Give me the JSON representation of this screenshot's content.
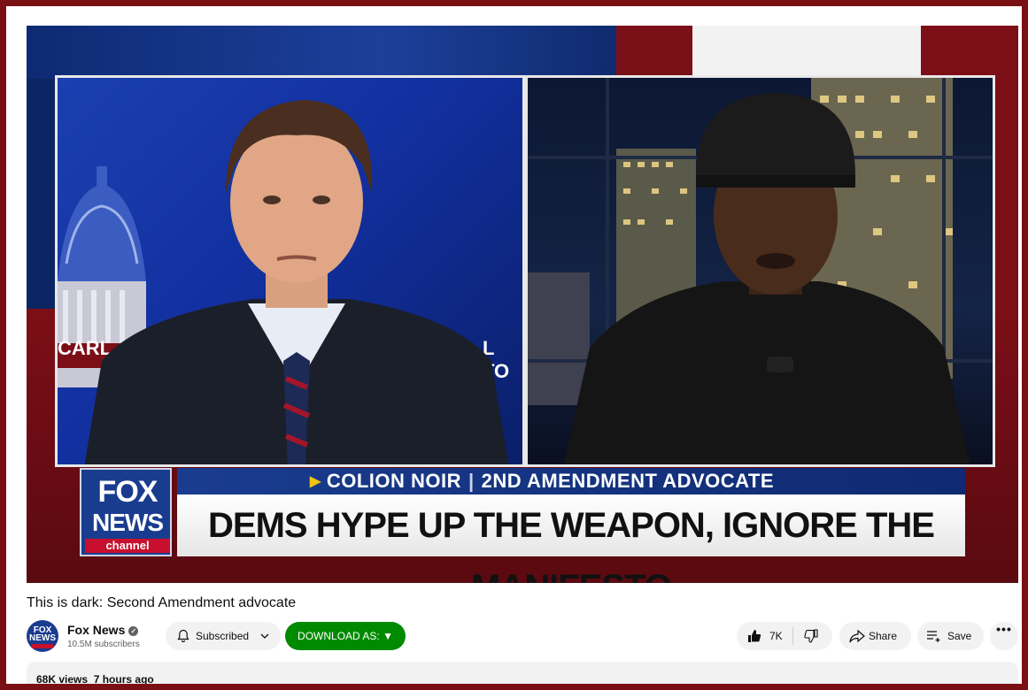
{
  "video": {
    "lower_third": {
      "logo_fox": "FOX",
      "logo_news": "NEWS",
      "logo_channel": "channel",
      "name": "COLION NOIR",
      "separator": "|",
      "role": "2ND AMENDMENT ADVOCATE",
      "headline": "DEMS HYPE UP THE WEAPON, IGNORE THE MANIFESTO"
    },
    "bg_texts": {
      "left_sign": "CARL",
      "right_sign": "L TO"
    }
  },
  "title": "This is dark: Second Amendment advocate",
  "channel": {
    "name": "Fox News",
    "subscribers": "10.5M subscribers",
    "avatar_line1": "FOX",
    "avatar_line2": "NEWS"
  },
  "actions": {
    "subscribed_label": "Subscribed",
    "download_label": "DOWNLOAD AS: ▼",
    "like_count": "7K",
    "share_label": "Share",
    "save_label": "Save",
    "more_label": "•••"
  },
  "description": {
    "views": "68K views",
    "time": "7 hours ago"
  },
  "colors": {
    "page_border": "#7a0f14",
    "download_green": "#008a00",
    "fox_blue": "#1a3c8f",
    "fox_red": "#c8102e"
  },
  "icons": [
    "bell-icon",
    "chevron-down-icon",
    "thumbs-up-icon",
    "thumbs-down-icon",
    "share-icon",
    "save-playlist-icon",
    "more-icon",
    "verified-icon"
  ]
}
